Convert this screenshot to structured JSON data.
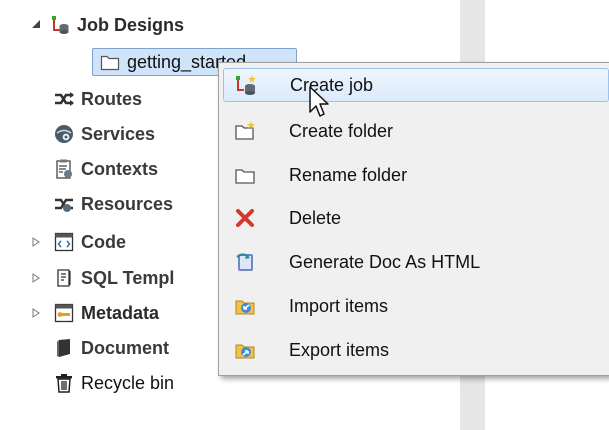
{
  "tree": {
    "job_designs": "Job Designs",
    "selected_folder": "getting_started",
    "routes": "Routes",
    "services": "Services",
    "contexts": "Contexts",
    "resources": "Resources",
    "code": "Code",
    "sql_templates": "SQL Templ",
    "metadata": "Metadata",
    "documentation": "Document",
    "recycle_bin": "Recycle bin"
  },
  "context_menu": {
    "create_job": "Create job",
    "create_folder": "Create folder",
    "rename_folder": "Rename folder",
    "delete": "Delete",
    "generate_doc": "Generate Doc As HTML",
    "import_items": "Import items",
    "export_items": "Export items"
  },
  "colors": {
    "selection": "#cfe3fa",
    "menu_background": "#f0f0f0",
    "delete_icon": "#d23a2c"
  }
}
